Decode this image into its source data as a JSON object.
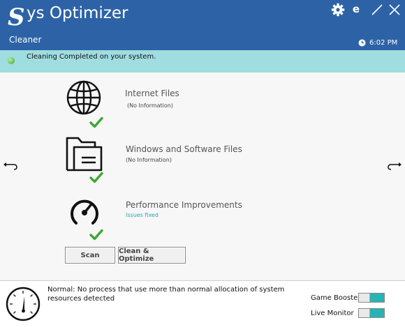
{
  "header": {
    "logo_letter": "S",
    "title": "ys Optimizer",
    "subtitle": "Cleaner",
    "time": "6:02 PM",
    "icons": [
      "gear-icon",
      "ie-icon",
      "minimize-icon",
      "close-icon",
      "clock-icon"
    ],
    "ie_label": "e"
  },
  "status": {
    "message": "Cleaning Completed on your system.",
    "indicator_color": "#35a52b"
  },
  "items": [
    {
      "title": "Internet Files",
      "sub": "(No Information)",
      "icon": "globe-icon",
      "done": true
    },
    {
      "title": "Windows and Software Files",
      "sub": "(No Information)",
      "icon": "folder-icon",
      "done": true
    },
    {
      "title": "Performance Improvements",
      "sub": "Issues fixed",
      "icon": "speedometer-icon",
      "done": true
    }
  ],
  "buttons": {
    "scan": "Scan",
    "clean": "Clean & Optimize"
  },
  "footer": {
    "message": "Normal: No process that use more than normal allocation of system resources detected",
    "toggles": [
      {
        "label": "Game Booster",
        "on": true
      },
      {
        "label": "Live Monitor",
        "on": true
      }
    ]
  },
  "colors": {
    "header": "#2d63a6",
    "status_bar": "#9fdde0",
    "check": "#3aa832",
    "toggle_on": "#2ab3b3",
    "issues_fixed": "#2aa3b0"
  }
}
